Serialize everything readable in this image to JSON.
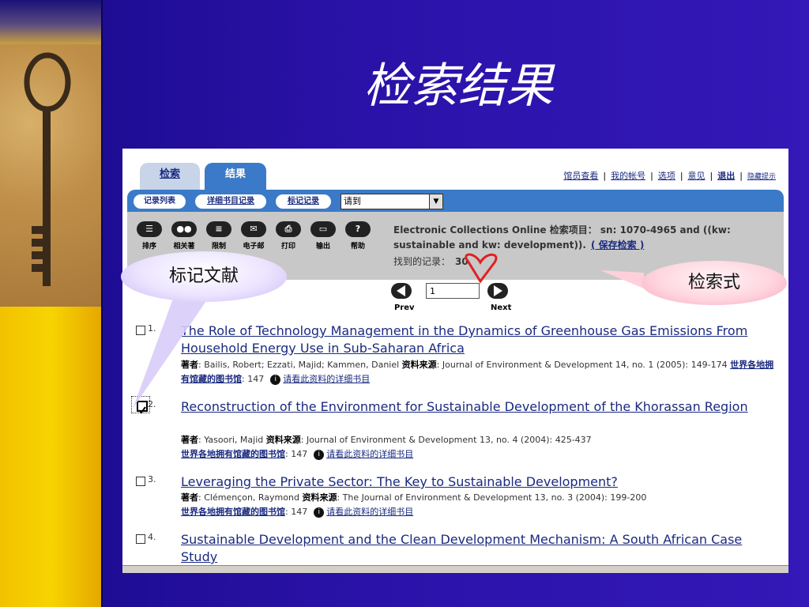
{
  "slide": {
    "title": "检索结果",
    "callout_mark": "标记文献",
    "callout_query": "检索式"
  },
  "tabs": [
    {
      "label": "检索"
    },
    {
      "label": "结果"
    }
  ],
  "top_links": [
    "馆员查看",
    "我的帐号",
    "选项",
    "意见",
    "退出",
    "隐藏提示"
  ],
  "subtabs": [
    "记录列表",
    "详细书目记录",
    "标记记录"
  ],
  "goto_select": {
    "value": "请到"
  },
  "toolbar": [
    {
      "label": "排序",
      "icon": "sort-icon"
    },
    {
      "label": "相关著",
      "icon": "related-icon"
    },
    {
      "label": "限制",
      "icon": "limit-icon"
    },
    {
      "label": "电子邮",
      "icon": "email-icon"
    },
    {
      "label": "打印",
      "icon": "print-icon"
    },
    {
      "label": "输出",
      "icon": "export-icon"
    },
    {
      "label": "帮助",
      "icon": "help-icon"
    }
  ],
  "query": {
    "text": "Electronic Collections Online 检索项目： sn: 1070-4965 and ((kw: sustainable and kw: development)).",
    "save_label": "( 保存检索 )",
    "found_label": "找到的记录：",
    "found_count": "30"
  },
  "pager": {
    "page_value": "1",
    "prev_label": "Prev",
    "next_label": "Next"
  },
  "records": [
    {
      "num": "1.",
      "title": "The Role of Technology Management in the Dynamics of Greenhouse Gas Emissions From Household Energy Use in Sub-Saharan Africa",
      "author_label": "著者",
      "author": ": Bailis, Robert; Ezzati, Majid; Kammen, Daniel",
      "source_label": "资料来源",
      "source": ": Journal of Environment & Development 14, no. 1 (2005): 149-174",
      "lib_label": "世界各地拥有馆藏的图书馆",
      "lib_count": ": 147",
      "detail_label": "请看此资料的详细书目",
      "checked": false
    },
    {
      "num": "2.",
      "title": "Reconstruction of the Environment for Sustainable Development of the Khorassan Region",
      "author_label": "著者",
      "author": ": Yasoori, Majid",
      "source_label": "资料来源",
      "source": ": Journal of Environment & Development 13, no. 4 (2004): 425-437",
      "lib_label": "世界各地拥有馆藏的图书馆",
      "lib_count": ": 147",
      "detail_label": "请看此资料的详细书目",
      "checked": true
    },
    {
      "num": "3.",
      "title": "Leveraging the Private Sector: The Key to Sustainable Development?",
      "author_label": "著者",
      "author": ": Clémençon, Raymond",
      "source_label": "资料来源",
      "source": ": The Journal of Environment & Development 13, no. 3 (2004): 199-200",
      "lib_label": "世界各地拥有馆藏的图书馆",
      "lib_count": ": 147",
      "detail_label": "请看此资料的详细书目",
      "checked": false
    },
    {
      "num": "4.",
      "title": "Sustainable Development and the Clean Development Mechanism: A South African Case Study",
      "checked": false
    }
  ],
  "colors": {
    "slide_bg": "#2a12a8",
    "accent_blue": "#3a7ac8",
    "link": "#1a2a80",
    "gold": "#f2c200",
    "highlight_red": "#e02020"
  }
}
